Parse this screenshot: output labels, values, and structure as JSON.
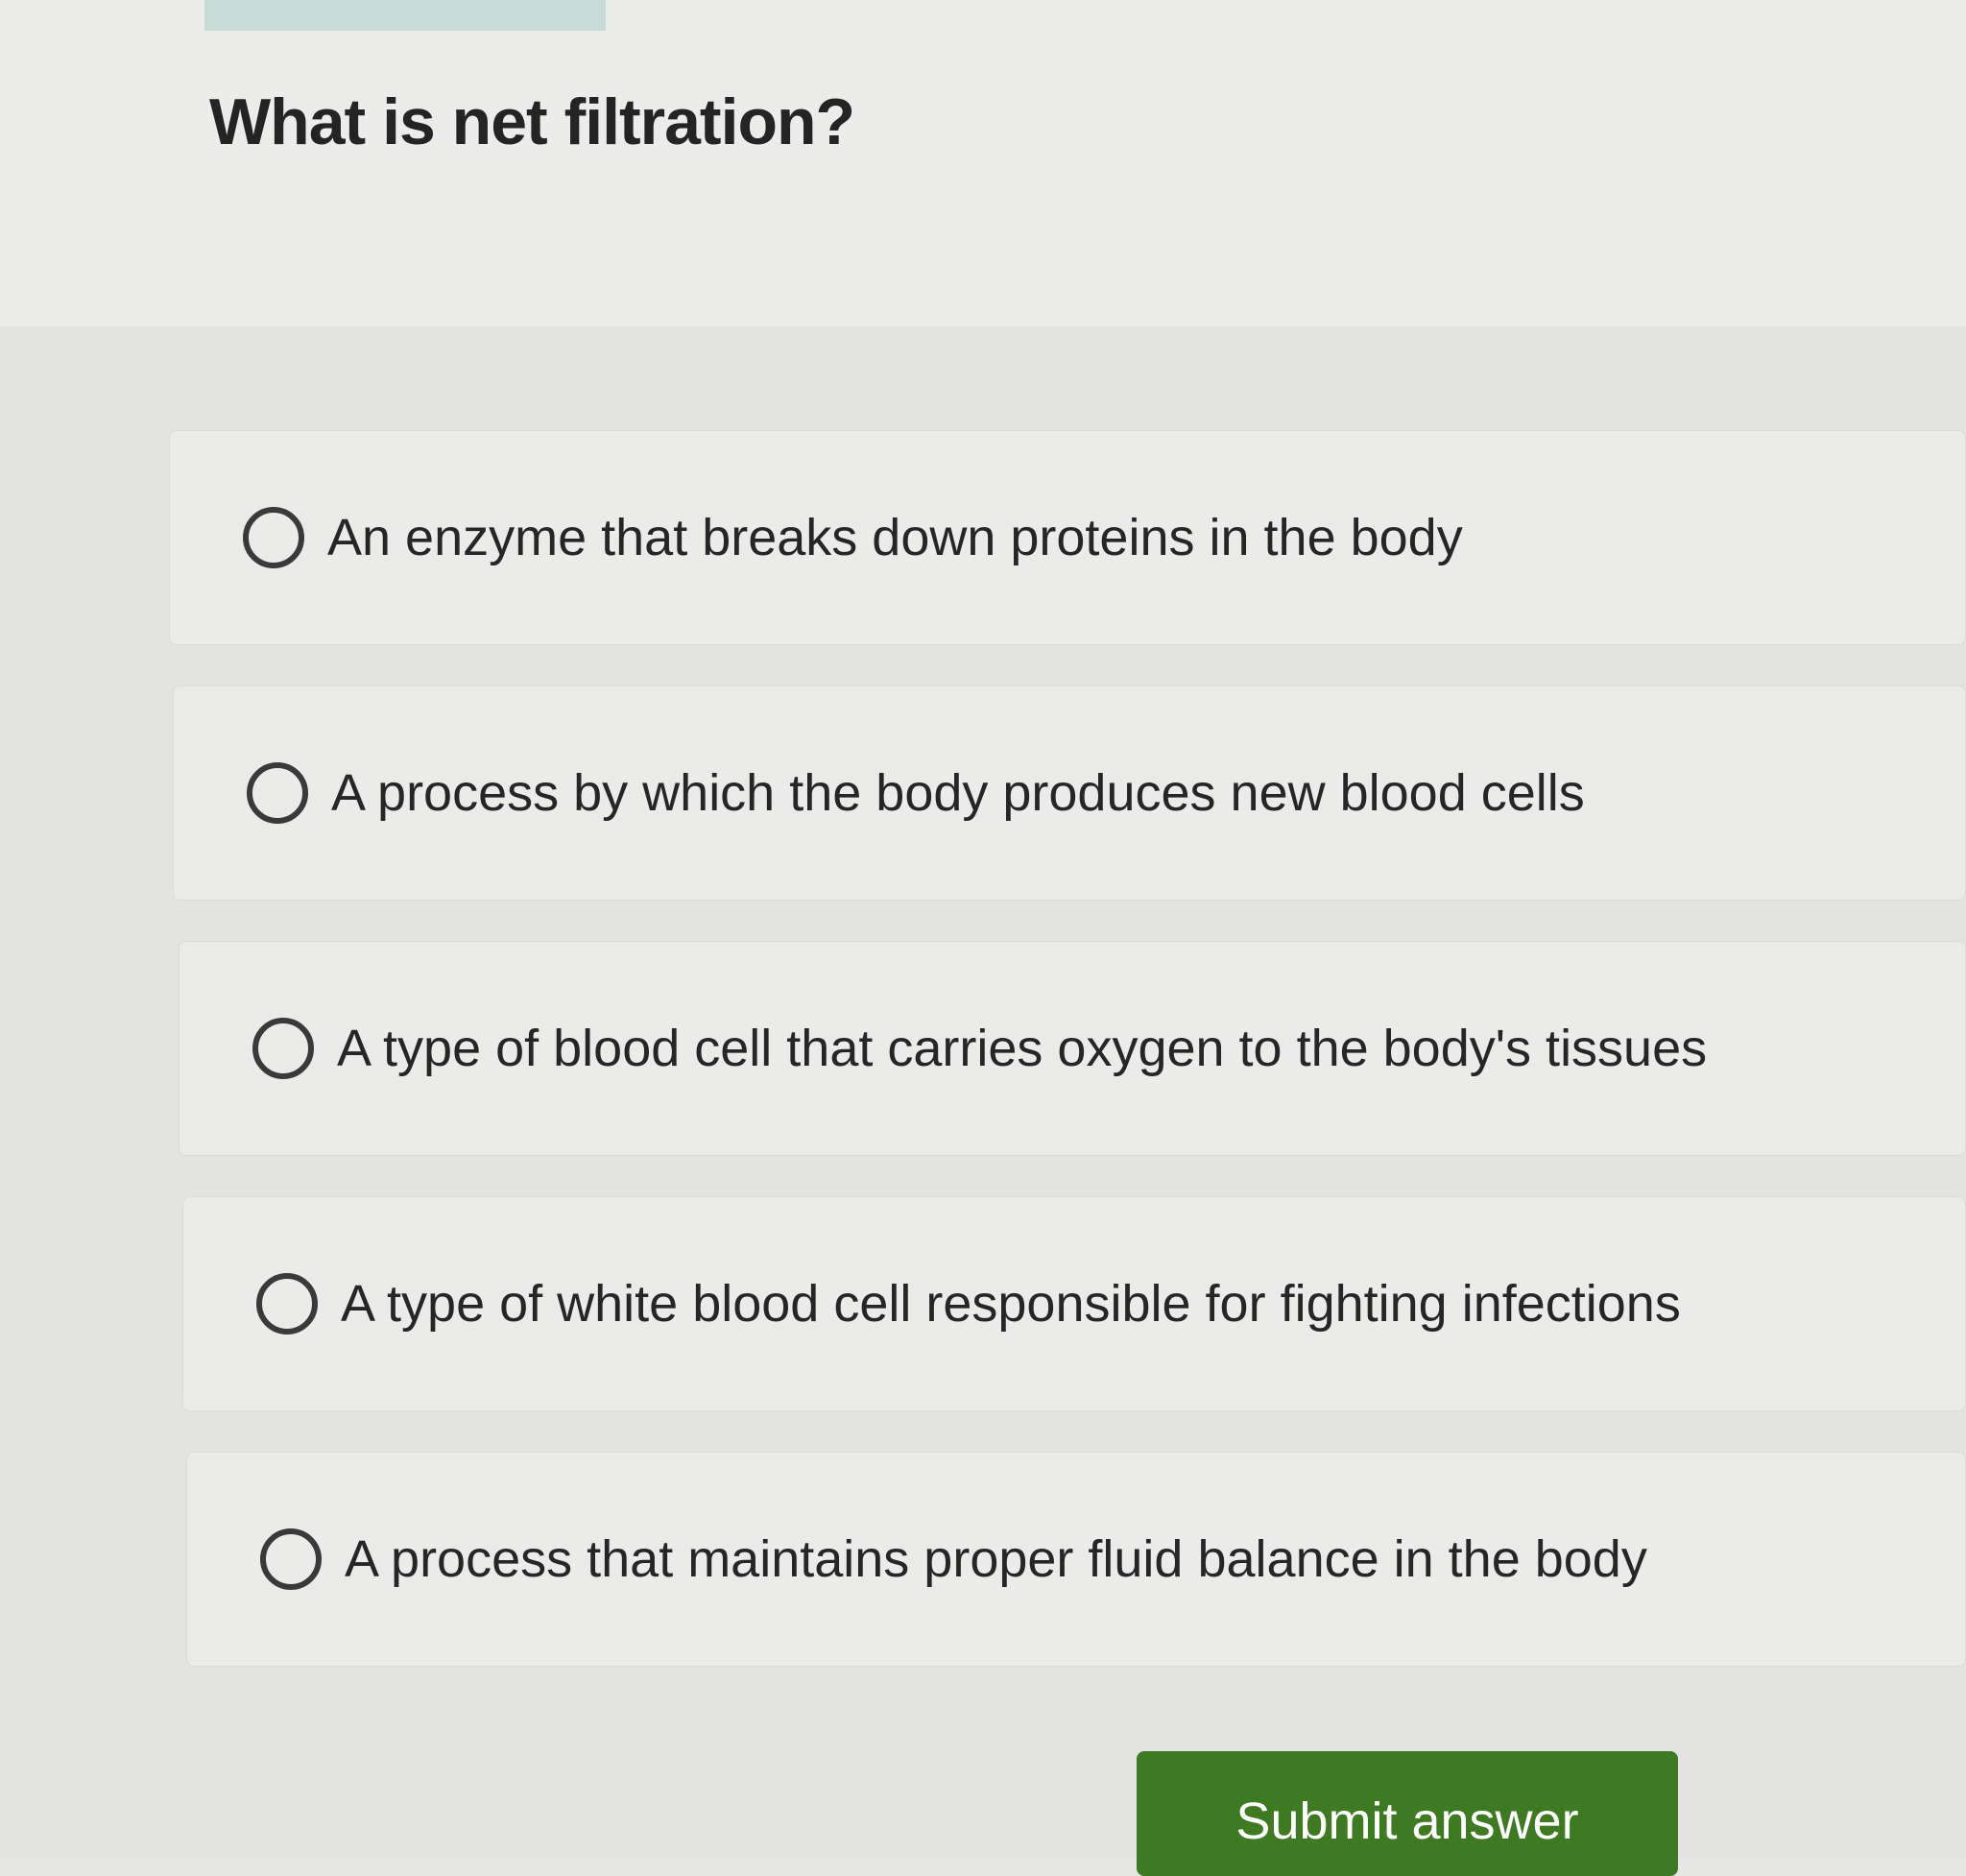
{
  "question": {
    "title": "What is net filtration?"
  },
  "options": [
    {
      "label": "An enzyme that breaks down proteins in the body",
      "selected": false
    },
    {
      "label": "A process by which the body produces new blood cells",
      "selected": false
    },
    {
      "label": "A type of blood cell that carries oxygen to the body's tissues",
      "selected": false
    },
    {
      "label": "A type of white blood cell responsible for fighting infections",
      "selected": false
    },
    {
      "label": "A process that maintains proper fluid balance in the body",
      "selected": false
    }
  ],
  "submit": {
    "label": "Submit answer"
  },
  "colors": {
    "submit_button": "#3e7a22",
    "progress_tab": "#c7dcd7"
  }
}
